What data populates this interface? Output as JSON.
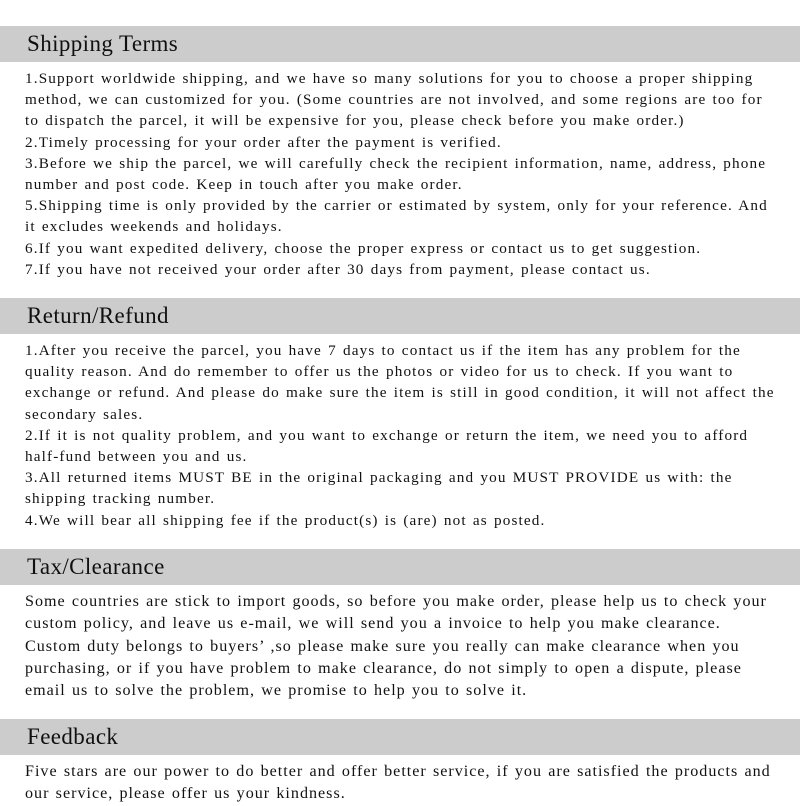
{
  "document": {
    "background_color": "#ffffff",
    "header_bar_color": "#cccccc",
    "text_color": "#111111"
  },
  "sections": [
    {
      "id": "shipping-terms",
      "heading": "Shipping Terms",
      "body": "1.Support worldwide shipping, and we have so many solutions for you to choose a proper shipping method, we can customized for you. (Some countries are not involved, and some regions are too for to dispatch the parcel, it will be expensive for you, please check before you make order.)\n2.Timely processing for your order after the payment is verified.\n3.Before we ship the parcel, we will carefully check the recipient information, name, address, phone number and post code. Keep in touch after you make order.\n5.Shipping time is only provided by the carrier or estimated by system, only for your reference. And it excludes weekends and holidays.\n6.If you want expedited delivery, choose the proper express or contact us to get suggestion.\n7.If you have not received your order after 30 days from payment, please contact us."
    },
    {
      "id": "return-refund",
      "heading": "Return/Refund",
      "body": "1.After you receive the parcel, you have 7 days to contact us if the item has any problem for the quality reason. And do remember to offer us the photos or video for us to check. If you want to exchange or refund. And please do make sure the item is still in good condition, it will not affect the secondary sales.\n2.If it is not quality problem, and you want to exchange or return the item, we need you to afford half-fund between you and us.\n3.All returned items MUST BE in the original packaging and you MUST PROVIDE us with: the shipping tracking number.\n4.We will bear all shipping fee if the product(s) is (are) not as posted."
    },
    {
      "id": "tax-clearance",
      "heading": "Tax/Clearance",
      "body": "Some countries are stick to import goods, so before you make order, please help us to check your custom policy, and leave us e-mail, we will send you a invoice to help you make clearance. Custom duty belongs to buyers’ ,so please make sure you really can make clearance when you purchasing, or if you have problem to make clearance, do not simply to open a dispute, please email us to solve the problem, we promise to help you to solve it."
    },
    {
      "id": "feedback",
      "heading": "Feedback",
      "body": "Five stars are our power to do better and offer better service, if you are satisfied the products and our service, please offer us your kindness."
    }
  ]
}
